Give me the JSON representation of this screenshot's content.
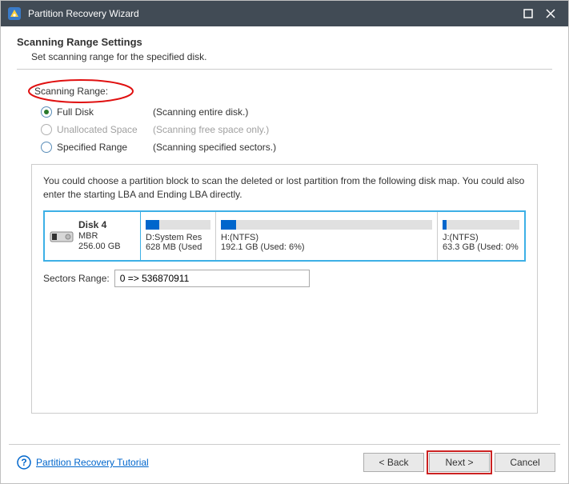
{
  "window": {
    "title": "Partition Recovery Wizard"
  },
  "header": {
    "heading": "Scanning Range Settings",
    "sub": "Set scanning range for the specified disk."
  },
  "section_label": "Scanning Range:",
  "radios": [
    {
      "label": "Full Disk",
      "desc": "(Scanning entire disk.)",
      "selected": true,
      "disabled": false
    },
    {
      "label": "Unallocated Space",
      "desc": "(Scanning free space only.)",
      "selected": false,
      "disabled": true
    },
    {
      "label": "Specified Range",
      "desc": "(Scanning specified sectors.)",
      "selected": false,
      "disabled": false
    }
  ],
  "panel": {
    "instructions": "You could choose a partition block to scan the deleted or lost partition from the following disk map. You could also enter the starting LBA and Ending LBA directly.",
    "disk": {
      "name": "Disk 4",
      "type": "MBR",
      "size": "256.00 GB"
    },
    "partitions": [
      {
        "name": "D:System Res",
        "detail": "628 MB (Used",
        "used_pct": 18
      },
      {
        "name": "H:(NTFS)",
        "detail": "192.1 GB (Used: 6%)",
        "used_pct": 6
      },
      {
        "name": "J:(NTFS)",
        "detail": "63.3 GB (Used: 0%",
        "used_pct": 2
      }
    ],
    "sectors_label": "Sectors Range:",
    "sectors_value": "0 => 536870911"
  },
  "tutorial_link": "Partition Recovery Tutorial",
  "buttons": {
    "back": "< Back",
    "next": "Next >",
    "cancel": "Cancel"
  }
}
